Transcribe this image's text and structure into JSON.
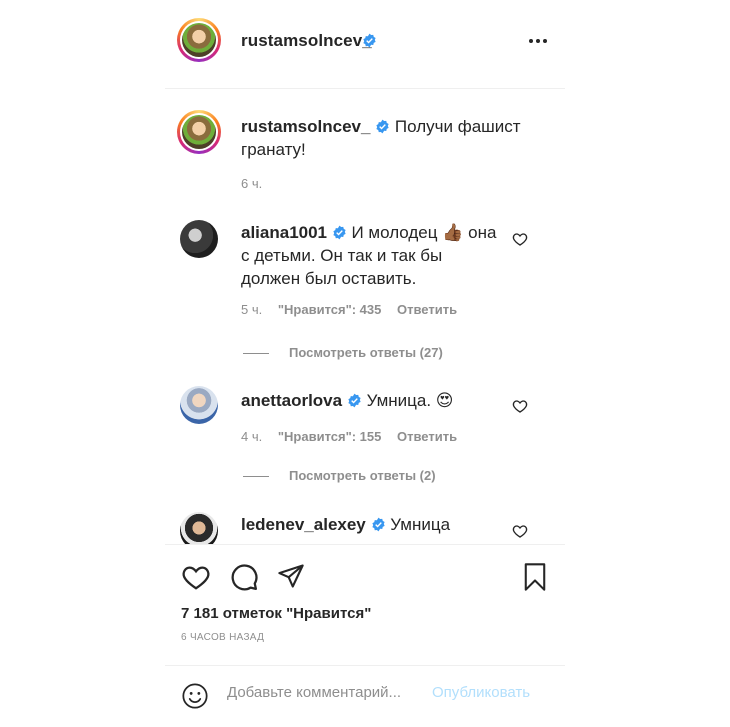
{
  "post_author": {
    "username": "rustamsolncev_",
    "verified": true,
    "avatar_icon": "profile-photo"
  },
  "header": {
    "more_icon": "more-horizontal-icon"
  },
  "caption": {
    "username": "rustamsolncev_",
    "text": "Получи фашист гранату!",
    "time": "6 ч."
  },
  "comments": [
    {
      "username": "aliana1001",
      "verified": true,
      "text": "И молодец 👍🏾 она с детьми. Он так и так бы должен был оставить.",
      "time": "5 ч.",
      "likes": "\"Нравится\": 435",
      "reply": "Ответить",
      "view_replies": "Посмотреть ответы (27)"
    },
    {
      "username": "anettaorlova",
      "verified": true,
      "text": "Умница. 😍",
      "time": "4 ч.",
      "likes": "\"Нравится\": 155",
      "reply": "Ответить",
      "view_replies": "Посмотреть ответы (2)"
    },
    {
      "username": "ledenev_alexey",
      "verified": true,
      "text": "Умница"
    }
  ],
  "actions": {
    "like_icon": "heart-icon",
    "comment_icon": "comment-icon",
    "share_icon": "paper-plane-icon",
    "save_icon": "bookmark-icon",
    "likes_count": "7 181 отметок \"Нравится\"",
    "time_ago": "6 часов назад"
  },
  "add_comment": {
    "emoji_icon": "smiley-icon",
    "placeholder": "Добавьте комментарий...",
    "publish_label": "Опубликовать"
  },
  "colors": {
    "verified_blue": "#3897f0",
    "muted_text": "#8e8e8e",
    "publish_disabled": "#b2dffc"
  }
}
